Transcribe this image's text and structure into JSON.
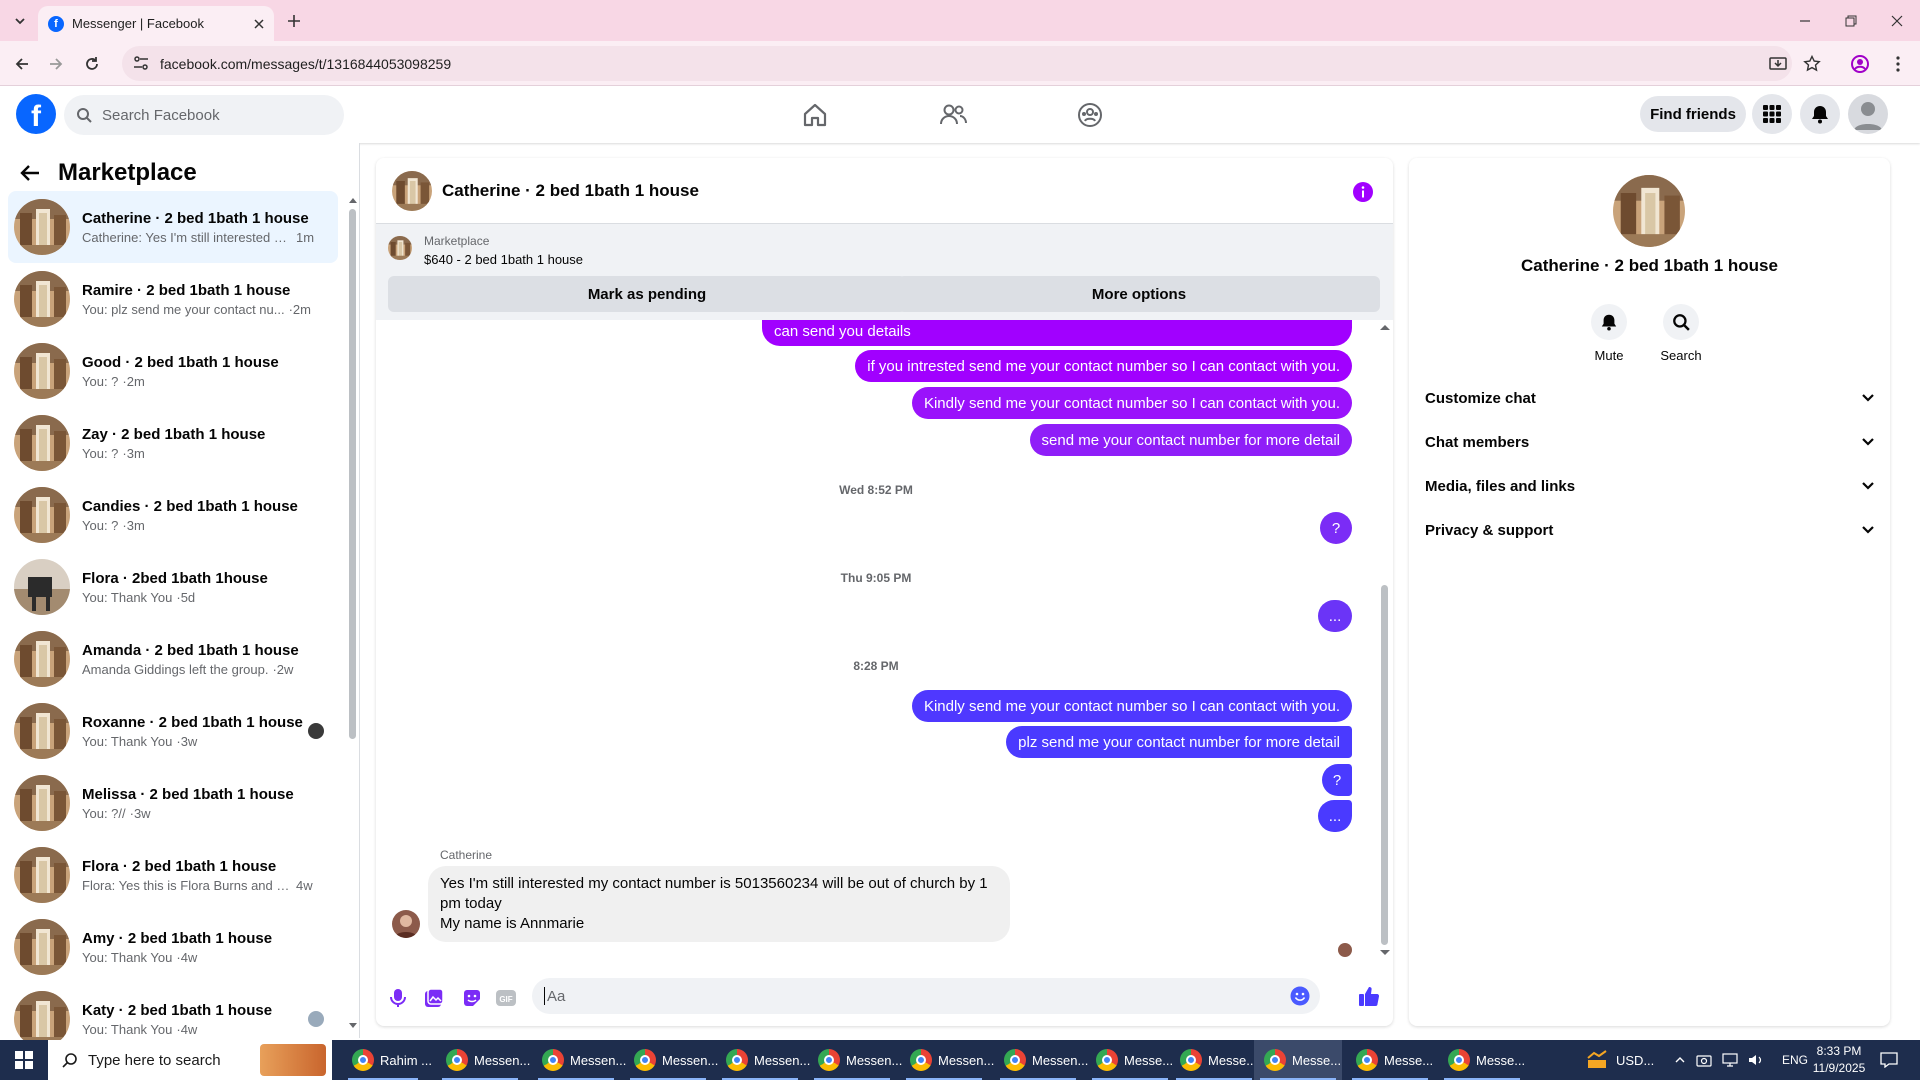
{
  "browser": {
    "tab_title": "Messenger | Facebook",
    "url": "facebook.com/messages/t/1316844053098259"
  },
  "fb": {
    "search_placeholder": "Search Facebook",
    "find_friends": "Find friends"
  },
  "left": {
    "title": "Marketplace",
    "conversations": [
      {
        "name": "Catherine · 2 bed 1bath 1 house",
        "preview": "Catherine: Yes I'm still interested m...",
        "time": "1m"
      },
      {
        "name": "Ramire · 2 bed 1bath 1 house",
        "preview": "You: plz send me your contact nu...",
        "time": "·2m"
      },
      {
        "name": "Good · 2 bed 1bath 1 house",
        "preview": "You: ?",
        "time": "·2m"
      },
      {
        "name": "Zay · 2 bed 1bath 1 house",
        "preview": "You: ?",
        "time": "·3m"
      },
      {
        "name": "Candies · 2 bed 1bath 1 house",
        "preview": "You: ?",
        "time": "·3m"
      },
      {
        "name": "Flora · 2bed 1bath 1house",
        "preview": "You: Thank You",
        "time": "·5d"
      },
      {
        "name": "Amanda · 2 bed 1bath 1 house",
        "preview": "Amanda Giddings left the group.",
        "time": "·2w"
      },
      {
        "name": "Roxanne · 2 bed 1bath 1 house",
        "preview": "You: Thank You",
        "time": "·3w"
      },
      {
        "name": "Melissa · 2 bed 1bath 1 house",
        "preview": "You: ?//",
        "time": "·3w"
      },
      {
        "name": "Flora · 2 bed 1bath 1 house",
        "preview": "Flora: Yes this is Flora Burns and I'...",
        "time": "4w"
      },
      {
        "name": "Amy · 2 bed 1bath 1 house",
        "preview": "You: Thank You",
        "time": "·4w"
      },
      {
        "name": "Katy · 2 bed 1bath 1 house",
        "preview": "You: Thank You",
        "time": "·4w"
      }
    ]
  },
  "chat": {
    "title": "Catherine · 2 bed 1bath 1 house",
    "listing_label": "Marketplace",
    "listing_detail": "$640 - 2 bed 1bath 1 house",
    "mark_pending": "Mark as pending",
    "more_options": "More options",
    "messages": [
      "can send you details",
      "if you intrested send me your contact number so I can contact with you.",
      "Kindly send me your contact number so I can contact with you.",
      "send me your contact number for more detail",
      "?",
      "...",
      "Kindly send me your contact number so I can contact with you.",
      "plz send me your contact number for more detail",
      "?",
      "..."
    ],
    "timestamps": [
      "Wed 8:52 PM",
      "Thu 9:05 PM",
      "8:28 PM"
    ],
    "incoming_sender": "Catherine",
    "incoming_lines": [
      "Yes I'm still interested my contact number is 5013560234 will be out of church by 1",
      "pm today",
      "My name is Annmarie"
    ],
    "compose_placeholder": "Aa"
  },
  "right": {
    "name": "Catherine · 2 bed 1bath 1 house",
    "mute": "Mute",
    "search": "Search",
    "sections": [
      "Customize chat",
      "Chat members",
      "Media, files and links",
      "Privacy & support"
    ]
  },
  "taskbar": {
    "search_placeholder": "Type here to search",
    "items": [
      "Rahim ...",
      "Messen...",
      "Messen...",
      "Messen...",
      "Messen...",
      "Messen...",
      "Messen...",
      "Messen...",
      "Messe...",
      "Messe...",
      "Messe...",
      "Messe...",
      "Messe..."
    ],
    "ticker": "USD...",
    "lang": "ENG",
    "time": "8:33 PM",
    "date": "11/9/2025"
  },
  "colors": {
    "messenger_purple": "#a100ff",
    "messenger_violet": "#7b2cf6",
    "messenger_blue": "#4a3aff",
    "fb_blue": "#0866ff"
  }
}
